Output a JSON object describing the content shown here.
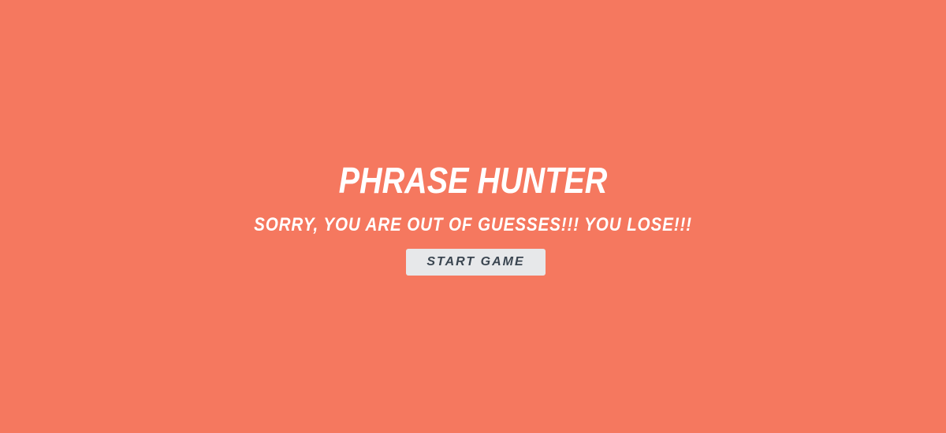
{
  "overlay": {
    "background_color": "#f5785f",
    "title": "Phrase Hunter",
    "message": "Sorry, you are out of guesses!!! You lose!!!",
    "start_button_label": "Start Game"
  }
}
